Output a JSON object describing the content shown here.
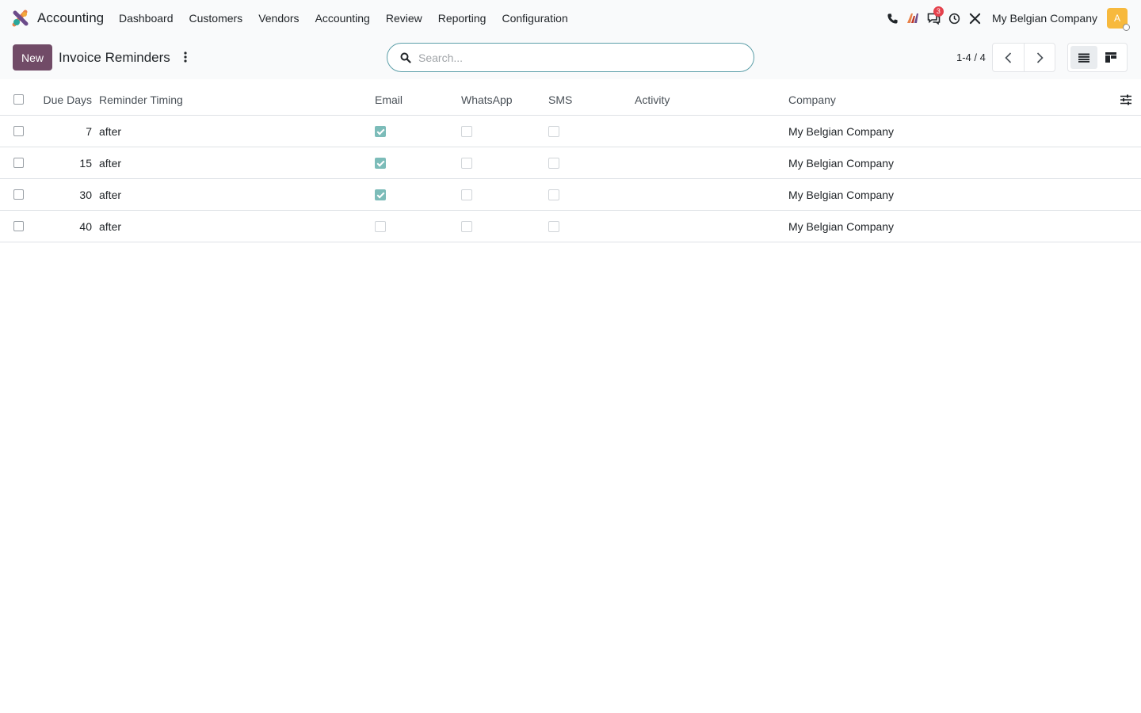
{
  "navbar": {
    "app_name": "Accounting",
    "menu": [
      "Dashboard",
      "Customers",
      "Vendors",
      "Accounting",
      "Review",
      "Reporting",
      "Configuration"
    ],
    "messages_badge": "3",
    "company": "My Belgian Company",
    "avatar_initial": "A",
    "icons": [
      "phone-icon",
      "ai-icon",
      "messages-icon",
      "clock-icon",
      "debug-tools-icon"
    ]
  },
  "control_panel": {
    "new_label": "New",
    "title": "Invoice Reminders",
    "search_placeholder": "Search...",
    "pager": "1-4 / 4"
  },
  "list": {
    "headers": {
      "due_days": "Due Days",
      "timing": "Reminder Timing",
      "email": "Email",
      "whatsapp": "WhatsApp",
      "sms": "SMS",
      "activity": "Activity",
      "company": "Company"
    },
    "rows": [
      {
        "due_days": "7",
        "timing": "after",
        "email": true,
        "whatsapp": false,
        "sms": false,
        "activity": "",
        "company": "My Belgian Company"
      },
      {
        "due_days": "15",
        "timing": "after",
        "email": true,
        "whatsapp": false,
        "sms": false,
        "activity": "",
        "company": "My Belgian Company"
      },
      {
        "due_days": "30",
        "timing": "after",
        "email": true,
        "whatsapp": false,
        "sms": false,
        "activity": "",
        "company": "My Belgian Company"
      },
      {
        "due_days": "40",
        "timing": "after",
        "email": false,
        "whatsapp": false,
        "sms": false,
        "activity": "",
        "company": "My Belgian Company"
      }
    ]
  },
  "colors": {
    "brand": "#714b67",
    "checkbox_checked": "#7cbcb9",
    "badge": "#e4424d",
    "avatar": "#f7b93d"
  }
}
